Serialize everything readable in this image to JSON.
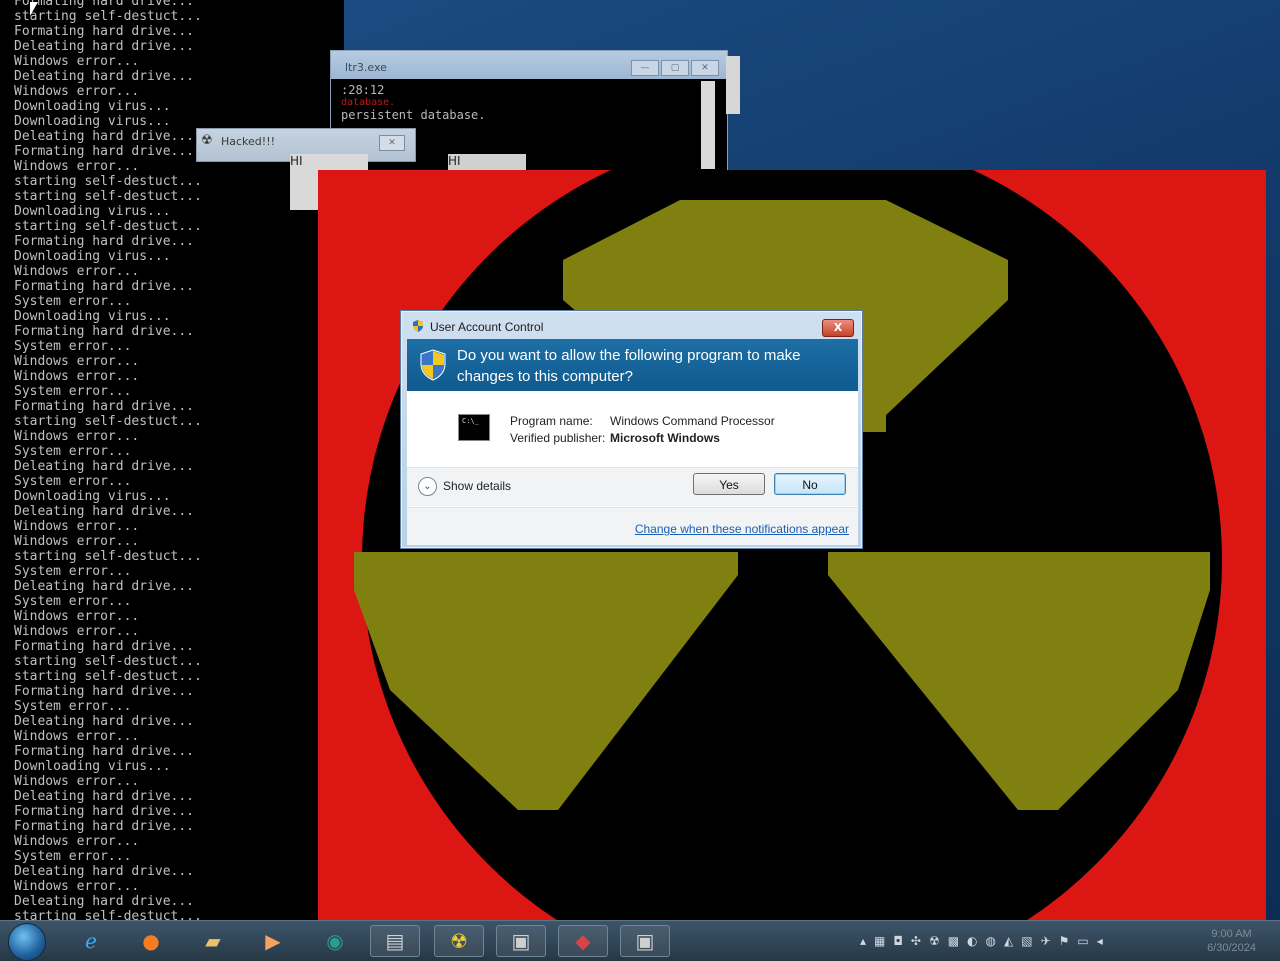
{
  "console": {
    "lines": [
      "Formating hard drive...",
      "starting self-destuct...",
      "Formating hard drive...",
      "Deleating hard drive...",
      "Windows error...",
      "Deleating hard drive...",
      "Windows error...",
      "Downloading virus...",
      "Downloading virus...",
      "Deleating hard drive...",
      "Formating hard drive...",
      "Windows error...",
      "starting self-destuct...",
      "starting self-destuct...",
      "Downloading virus...",
      "starting self-destuct...",
      "Formating hard drive...",
      "Downloading virus...",
      "Windows error...",
      "Formating hard drive...",
      "System error...",
      "Downloading virus...",
      "Formating hard drive...",
      "System error...",
      "Windows error...",
      "Windows error...",
      "System error...",
      "Formating hard drive...",
      "starting self-destuct...",
      "Windows error...",
      "System error...",
      "Deleating hard drive...",
      "System error...",
      "Downloading virus...",
      "Deleating hard drive...",
      "Windows error...",
      "Windows error...",
      "starting self-destuct...",
      "System error...",
      "Deleating hard drive...",
      "System error...",
      "Windows error...",
      "Windows error...",
      "Formating hard drive...",
      "starting self-destuct...",
      "starting self-destuct...",
      "Formating hard drive...",
      "System error...",
      "Deleating hard drive...",
      "Windows error...",
      "Formating hard drive...",
      "Downloading virus...",
      "Windows error...",
      "Deleating hard drive...",
      "Formating hard drive...",
      "Formating hard drive...",
      "Windows error...",
      "System error...",
      "Deleating hard drive...",
      "Windows error...",
      "Deleating hard drive...",
      "starting self-destuct..."
    ]
  },
  "background_window": {
    "title": "ltr3.exe",
    "line1": ":28:12",
    "line2_red": "database.",
    "line3": "persistent database."
  },
  "mini_popup": {
    "title": "Hacked!!!",
    "hi1": "HI",
    "hi2": "HI"
  },
  "nuke": {
    "red": "#dc1612",
    "yellow": "#808010",
    "black": "#000000"
  },
  "uac": {
    "title": "User Account Control",
    "close_label": "X",
    "question": "Do you want to allow the following program to make changes to this computer?",
    "program_name_label": "Program name:",
    "program_name": "Windows Command Processor",
    "publisher_label": "Verified publisher:",
    "publisher": "Microsoft Windows",
    "cmd_icon_text": "C:\\_",
    "show_details": "Show details",
    "yes_label": "Yes",
    "no_label": "No",
    "change_link": "Change when these notifications appear"
  },
  "taskbar": {
    "clock_time": "9:00 AM",
    "clock_date": "6/30/2024"
  }
}
